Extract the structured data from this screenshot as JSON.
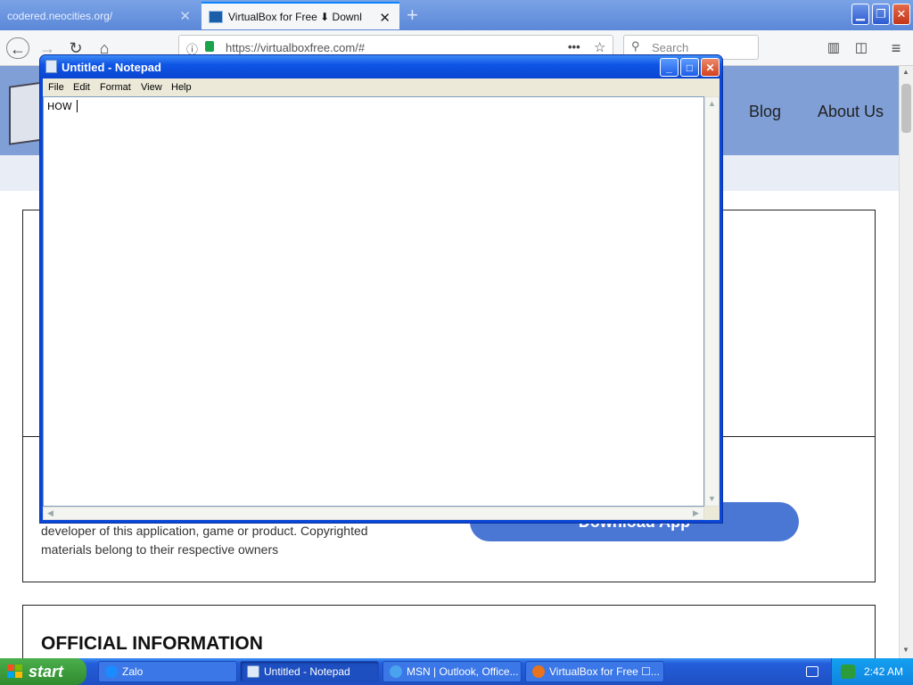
{
  "browser": {
    "tabs": [
      {
        "label": "codered.neocities.org/",
        "active": false
      },
      {
        "label": "VirtualBox for Free ⬇ Download V",
        "active": true
      }
    ],
    "url": "https://virtualboxfree.com/#",
    "search_placeholder": "Search",
    "new_tab_symbol": "+"
  },
  "site": {
    "nav_links": [
      "Blog",
      "About Us"
    ],
    "download_button": "Download App",
    "disclaimer": "developer of this application, game or product. Copyrighted materials belong to their respective owners",
    "section_heading": "OFFICIAL INFORMATION"
  },
  "notepad": {
    "title": "Untitled - Notepad",
    "menu": [
      "File",
      "Edit",
      "Format",
      "View",
      "Help"
    ],
    "text": "HOW"
  },
  "taskbar": {
    "start_label": "start",
    "tasks": [
      {
        "label": "Zalo",
        "icon": "zalo-icon"
      },
      {
        "label": "Untitled - Notepad",
        "icon": "notepad-icon",
        "active": true
      },
      {
        "label": "MSN | Outlook, Office...",
        "icon": "ie-icon"
      },
      {
        "label": "VirtualBox for Free ☐...",
        "icon": "firefox-icon"
      }
    ],
    "clock": "2:42 AM"
  },
  "colors": {
    "xp_blue": "#245edb",
    "start_green": "#2f8b2f",
    "site_header": "#7f9fd6",
    "download_button": "#4a76d4"
  }
}
